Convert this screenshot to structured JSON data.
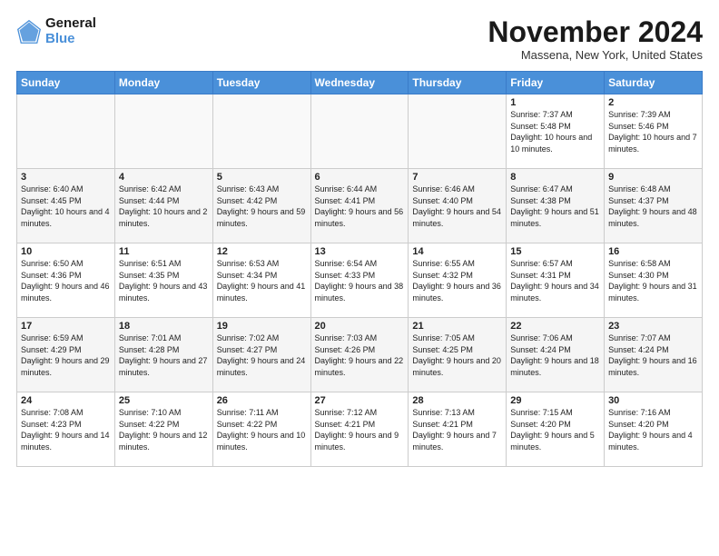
{
  "logo": {
    "line1": "General",
    "line2": "Blue"
  },
  "title": "November 2024",
  "location": "Massena, New York, United States",
  "days_header": [
    "Sunday",
    "Monday",
    "Tuesday",
    "Wednesday",
    "Thursday",
    "Friday",
    "Saturday"
  ],
  "weeks": [
    [
      {
        "day": "",
        "info": ""
      },
      {
        "day": "",
        "info": ""
      },
      {
        "day": "",
        "info": ""
      },
      {
        "day": "",
        "info": ""
      },
      {
        "day": "",
        "info": ""
      },
      {
        "day": "1",
        "info": "Sunrise: 7:37 AM\nSunset: 5:48 PM\nDaylight: 10 hours and 10 minutes."
      },
      {
        "day": "2",
        "info": "Sunrise: 7:39 AM\nSunset: 5:46 PM\nDaylight: 10 hours and 7 minutes."
      }
    ],
    [
      {
        "day": "3",
        "info": "Sunrise: 6:40 AM\nSunset: 4:45 PM\nDaylight: 10 hours and 4 minutes."
      },
      {
        "day": "4",
        "info": "Sunrise: 6:42 AM\nSunset: 4:44 PM\nDaylight: 10 hours and 2 minutes."
      },
      {
        "day": "5",
        "info": "Sunrise: 6:43 AM\nSunset: 4:42 PM\nDaylight: 9 hours and 59 minutes."
      },
      {
        "day": "6",
        "info": "Sunrise: 6:44 AM\nSunset: 4:41 PM\nDaylight: 9 hours and 56 minutes."
      },
      {
        "day": "7",
        "info": "Sunrise: 6:46 AM\nSunset: 4:40 PM\nDaylight: 9 hours and 54 minutes."
      },
      {
        "day": "8",
        "info": "Sunrise: 6:47 AM\nSunset: 4:38 PM\nDaylight: 9 hours and 51 minutes."
      },
      {
        "day": "9",
        "info": "Sunrise: 6:48 AM\nSunset: 4:37 PM\nDaylight: 9 hours and 48 minutes."
      }
    ],
    [
      {
        "day": "10",
        "info": "Sunrise: 6:50 AM\nSunset: 4:36 PM\nDaylight: 9 hours and 46 minutes."
      },
      {
        "day": "11",
        "info": "Sunrise: 6:51 AM\nSunset: 4:35 PM\nDaylight: 9 hours and 43 minutes."
      },
      {
        "day": "12",
        "info": "Sunrise: 6:53 AM\nSunset: 4:34 PM\nDaylight: 9 hours and 41 minutes."
      },
      {
        "day": "13",
        "info": "Sunrise: 6:54 AM\nSunset: 4:33 PM\nDaylight: 9 hours and 38 minutes."
      },
      {
        "day": "14",
        "info": "Sunrise: 6:55 AM\nSunset: 4:32 PM\nDaylight: 9 hours and 36 minutes."
      },
      {
        "day": "15",
        "info": "Sunrise: 6:57 AM\nSunset: 4:31 PM\nDaylight: 9 hours and 34 minutes."
      },
      {
        "day": "16",
        "info": "Sunrise: 6:58 AM\nSunset: 4:30 PM\nDaylight: 9 hours and 31 minutes."
      }
    ],
    [
      {
        "day": "17",
        "info": "Sunrise: 6:59 AM\nSunset: 4:29 PM\nDaylight: 9 hours and 29 minutes."
      },
      {
        "day": "18",
        "info": "Sunrise: 7:01 AM\nSunset: 4:28 PM\nDaylight: 9 hours and 27 minutes."
      },
      {
        "day": "19",
        "info": "Sunrise: 7:02 AM\nSunset: 4:27 PM\nDaylight: 9 hours and 24 minutes."
      },
      {
        "day": "20",
        "info": "Sunrise: 7:03 AM\nSunset: 4:26 PM\nDaylight: 9 hours and 22 minutes."
      },
      {
        "day": "21",
        "info": "Sunrise: 7:05 AM\nSunset: 4:25 PM\nDaylight: 9 hours and 20 minutes."
      },
      {
        "day": "22",
        "info": "Sunrise: 7:06 AM\nSunset: 4:24 PM\nDaylight: 9 hours and 18 minutes."
      },
      {
        "day": "23",
        "info": "Sunrise: 7:07 AM\nSunset: 4:24 PM\nDaylight: 9 hours and 16 minutes."
      }
    ],
    [
      {
        "day": "24",
        "info": "Sunrise: 7:08 AM\nSunset: 4:23 PM\nDaylight: 9 hours and 14 minutes."
      },
      {
        "day": "25",
        "info": "Sunrise: 7:10 AM\nSunset: 4:22 PM\nDaylight: 9 hours and 12 minutes."
      },
      {
        "day": "26",
        "info": "Sunrise: 7:11 AM\nSunset: 4:22 PM\nDaylight: 9 hours and 10 minutes."
      },
      {
        "day": "27",
        "info": "Sunrise: 7:12 AM\nSunset: 4:21 PM\nDaylight: 9 hours and 9 minutes."
      },
      {
        "day": "28",
        "info": "Sunrise: 7:13 AM\nSunset: 4:21 PM\nDaylight: 9 hours and 7 minutes."
      },
      {
        "day": "29",
        "info": "Sunrise: 7:15 AM\nSunset: 4:20 PM\nDaylight: 9 hours and 5 minutes."
      },
      {
        "day": "30",
        "info": "Sunrise: 7:16 AM\nSunset: 4:20 PM\nDaylight: 9 hours and 4 minutes."
      }
    ]
  ]
}
